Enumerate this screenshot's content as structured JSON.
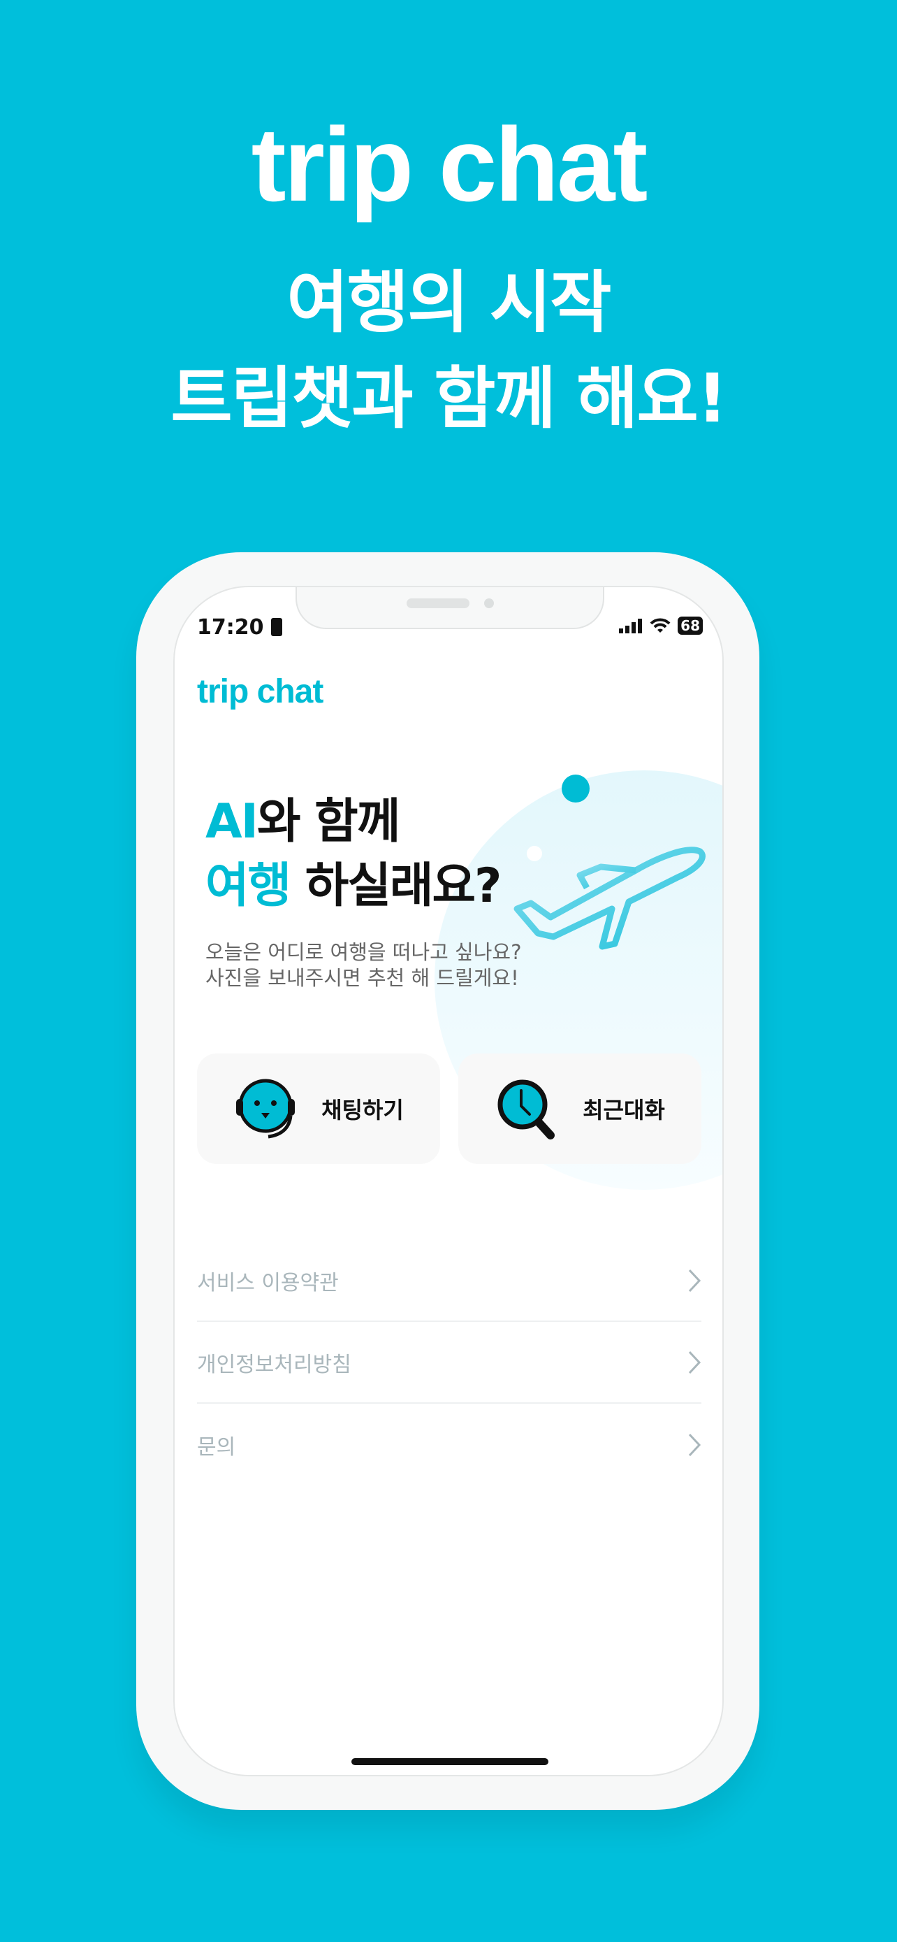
{
  "promo": {
    "title": "trip chat",
    "line1": "여행의 시작",
    "line2": "트립챗과 함께 해요!"
  },
  "status": {
    "time": "17:20",
    "battery": "68"
  },
  "app": {
    "logo": "trip chat",
    "headline": {
      "accent1": "AI",
      "rest1": "와 함께",
      "accent2": "여행",
      "rest2": " 하실래요?"
    },
    "subtitle": {
      "line1": "오늘은 어디로 여행을 떠나고 싶나요?",
      "line2": "사진을 보내주시면 추천 해 드릴게요!"
    },
    "actions": [
      {
        "label": "채팅하기",
        "icon": "headset-face-icon"
      },
      {
        "label": "최근대화",
        "icon": "clock-search-icon"
      }
    ],
    "menu": [
      {
        "label": "서비스 이용약관"
      },
      {
        "label": "개인정보처리방침"
      },
      {
        "label": "문의"
      }
    ]
  },
  "colors": {
    "background": "#00bfdb",
    "accent": "#00bcd4"
  }
}
